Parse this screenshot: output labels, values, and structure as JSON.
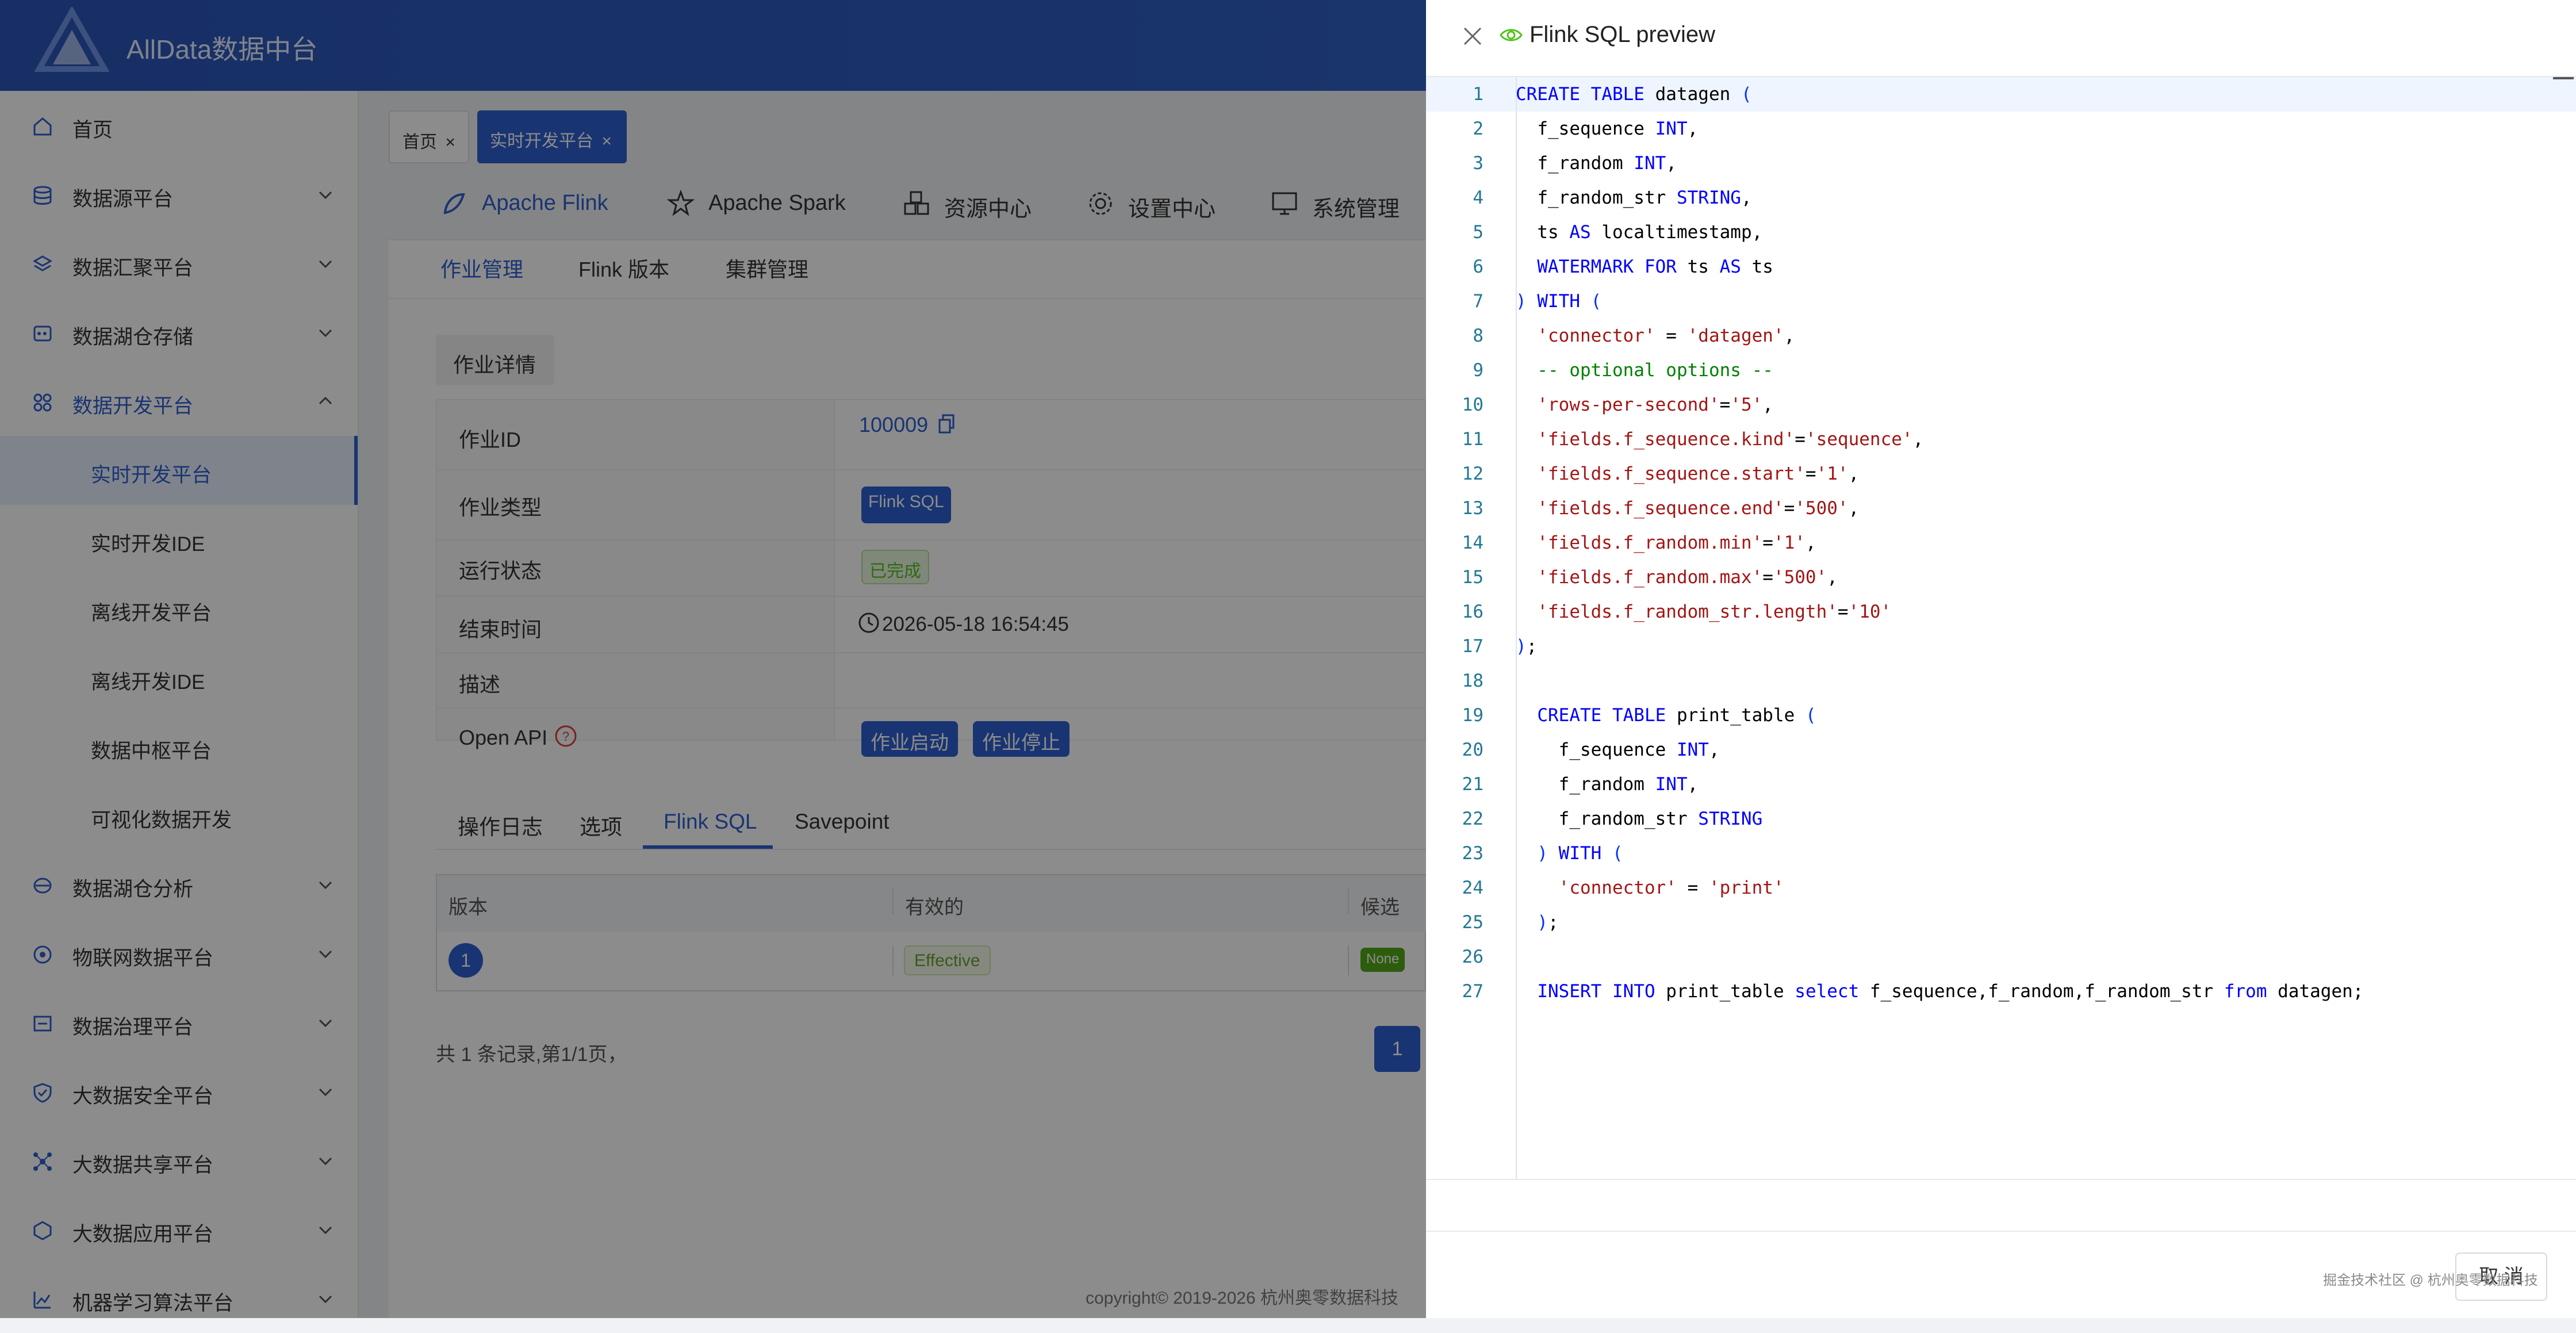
{
  "app": {
    "title": "AllData数据中台"
  },
  "sidebar": {
    "items": [
      {
        "label": "首页",
        "icon": "home-icon"
      },
      {
        "label": "数据源平台",
        "icon": "database-icon"
      },
      {
        "label": "数据汇聚平台",
        "icon": "layers-icon"
      },
      {
        "label": "数据湖仓存储",
        "icon": "storage-icon"
      },
      {
        "label": "数据开发平台",
        "icon": "grid-icon"
      },
      {
        "label": "数据湖仓分析",
        "icon": "analysis-icon"
      },
      {
        "label": "物联网数据平台",
        "icon": "iot-icon"
      },
      {
        "label": "数据治理平台",
        "icon": "governance-icon"
      },
      {
        "label": "大数据安全平台",
        "icon": "shield-icon"
      },
      {
        "label": "大数据共享平台",
        "icon": "share-icon"
      },
      {
        "label": "大数据应用平台",
        "icon": "app-icon"
      },
      {
        "label": "机器学习算法平台",
        "icon": "ml-icon"
      }
    ],
    "sub_items": [
      "实时开发平台",
      "实时开发IDE",
      "离线开发平台",
      "离线开发IDE",
      "数据中枢平台",
      "可视化数据开发"
    ]
  },
  "page_tabs": [
    {
      "label": "首页",
      "close": "×"
    },
    {
      "label": "实时开发平台",
      "close": "×"
    }
  ],
  "top_tabs": [
    {
      "label": "Apache Flink"
    },
    {
      "label": "Apache Spark"
    },
    {
      "label": "资源中心"
    },
    {
      "label": "设置中心"
    },
    {
      "label": "系统管理"
    }
  ],
  "sub_tabs": [
    "作业管理",
    "Flink 版本",
    "集群管理"
  ],
  "detail": {
    "section_title": "作业详情",
    "rows": {
      "job_id_label": "作业ID",
      "job_id_value": "100009",
      "job_type_label": "作业类型",
      "job_type_value": "Flink SQL",
      "status_label": "运行状态",
      "status_value": "已完成",
      "end_time_label": "结束时间",
      "end_time_value": "2026-05-18 16:54:45",
      "desc_label": "描述",
      "api_label": "Open API",
      "api_start": "作业启动",
      "api_stop": "作业停止"
    }
  },
  "log_tabs": [
    "操作日志",
    "选项",
    "Flink SQL",
    "Savepoint"
  ],
  "version_table": {
    "headers": [
      "版本",
      "有效的",
      "候选"
    ],
    "row": {
      "version": "1",
      "effective": "Effective",
      "candidate": "None"
    }
  },
  "pagination": {
    "summary": "共 1 条记录,第1/1页，",
    "page": "1"
  },
  "footer": {
    "copyright": "copyright© 2019-2026 杭州奥零数据科技"
  },
  "drawer": {
    "title": "Flink SQL preview",
    "cancel_label": "取 消",
    "watermark": "掘金技术社区 @ 杭州奥零数据科技",
    "code_lines": [
      "CREATE TABLE datagen (",
      "  f_sequence INT,",
      "  f_random INT,",
      "  f_random_str STRING,",
      "  ts AS localtimestamp,",
      "  WATERMARK FOR ts AS ts",
      ") WITH (",
      "  'connector' = 'datagen',",
      "  -- optional options --",
      "  'rows-per-second'='5',",
      "  'fields.f_sequence.kind'='sequence',",
      "  'fields.f_sequence.start'='1',",
      "  'fields.f_sequence.end'='500',",
      "  'fields.f_random.min'='1',",
      "  'fields.f_random.max'='500',",
      "  'fields.f_random_str.length'='10'",
      ");",
      "",
      "  CREATE TABLE print_table (",
      "    f_sequence INT,",
      "    f_random INT,",
      "    f_random_str STRING",
      "  ) WITH (",
      "    'connector' = 'print'",
      "  );",
      "",
      "  INSERT INTO print_table select f_sequence,f_random,f_random_str from datagen;"
    ]
  },
  "colors": {
    "primary": "#2f5fd0",
    "success": "#52c41a",
    "header": "#2a56b8"
  }
}
